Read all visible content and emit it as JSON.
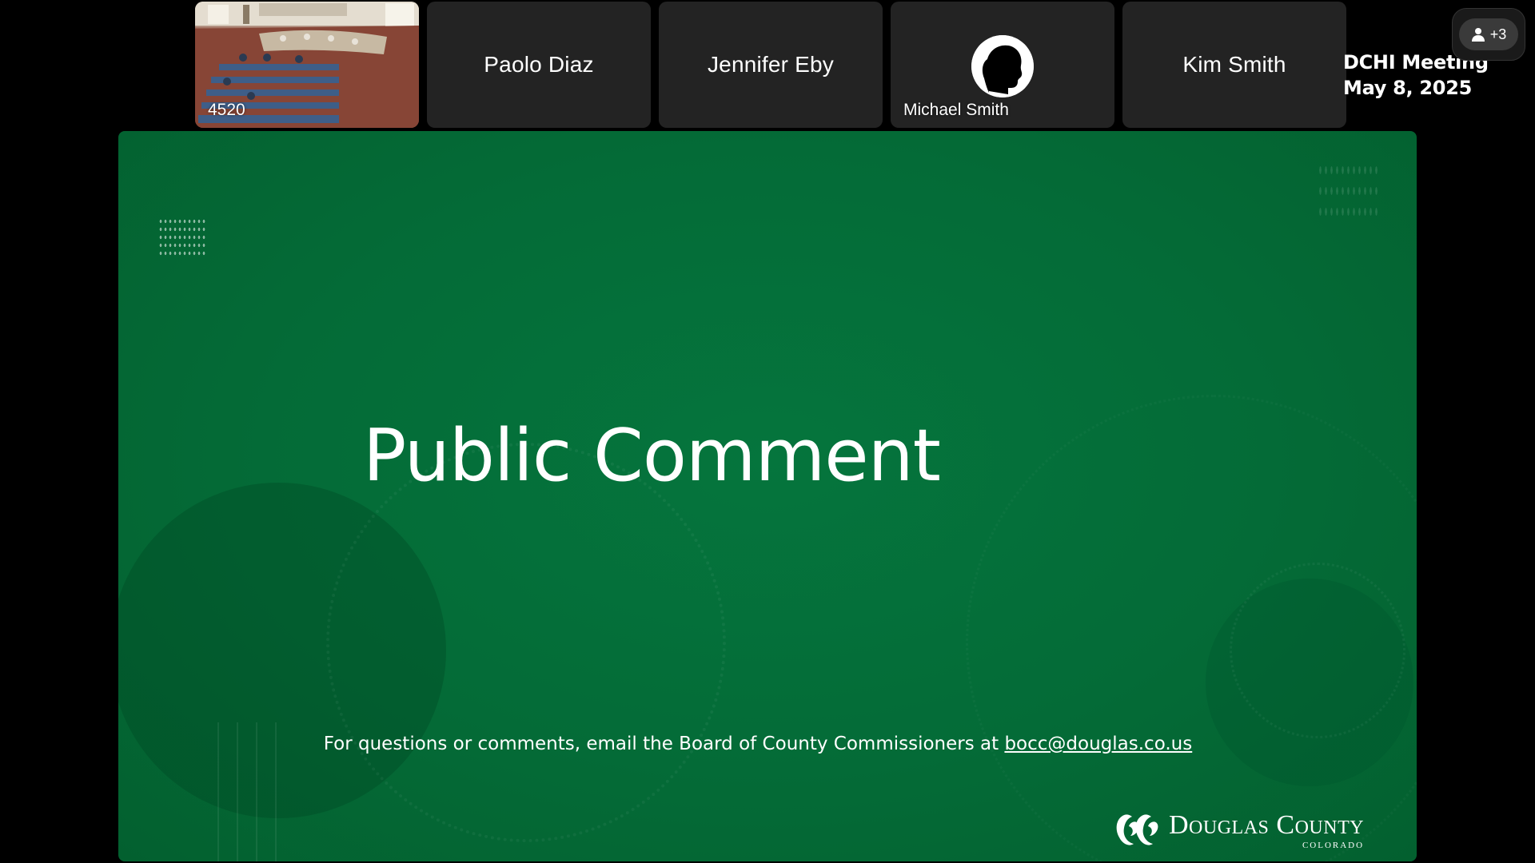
{
  "participants": [
    {
      "name": "4520",
      "type": "video"
    },
    {
      "name": "Paolo Diaz",
      "type": "name"
    },
    {
      "name": "Jennifer Eby",
      "type": "name"
    },
    {
      "name": "Michael Smith",
      "type": "avatar"
    },
    {
      "name": "Kim Smith",
      "type": "name"
    }
  ],
  "meeting": {
    "title_line1": "DCHI Meeting",
    "title_line2": "May 8, 2025"
  },
  "participants_button": {
    "count_label": "+3",
    "icon": "person-icon"
  },
  "slide": {
    "title": "Public Comment",
    "footer_text": "For questions or comments, email the Board of County Commissioners at ",
    "footer_link": "bocc@douglas.co.us",
    "logo_main": "Douglas County",
    "logo_sub": "COLORADO",
    "background_color": "#046b37"
  }
}
